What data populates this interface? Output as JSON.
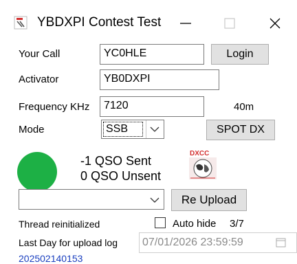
{
  "window": {
    "title": "YBDXPI Contest Test",
    "icons": {
      "app": "app-logo-icon",
      "minimize": "minimize-icon",
      "maximize": "maximize-icon",
      "close": "close-icon"
    }
  },
  "form": {
    "your_call_label": "Your Call",
    "your_call_value": "YC0HLE",
    "login_label": "Login",
    "activator_label": "Activator",
    "activator_value": "YB0DXPI",
    "frequency_label": "Frequency KHz",
    "frequency_value": "7120",
    "band": "40m",
    "mode_label": "Mode",
    "mode_value": "SSB",
    "spot_label": "SPOT DX"
  },
  "status": {
    "indicator_color": "#1db045",
    "qso_sent": "-1 QSO Sent",
    "qso_unsent": "0 QSO Unsent",
    "logo_text": "DXCC"
  },
  "upload": {
    "combo_value": "",
    "reupload_label": "Re Upload"
  },
  "footer": {
    "thread_status": "Thread reinitialized",
    "autohide_label": "Auto hide",
    "autohide_checked": false,
    "counter": "3/7",
    "last_day_label": "Last Day for upload  log",
    "last_day_value": "07/01/2026 23:59:59",
    "version": "202502140153",
    "version_color": "#1a3fbf"
  }
}
